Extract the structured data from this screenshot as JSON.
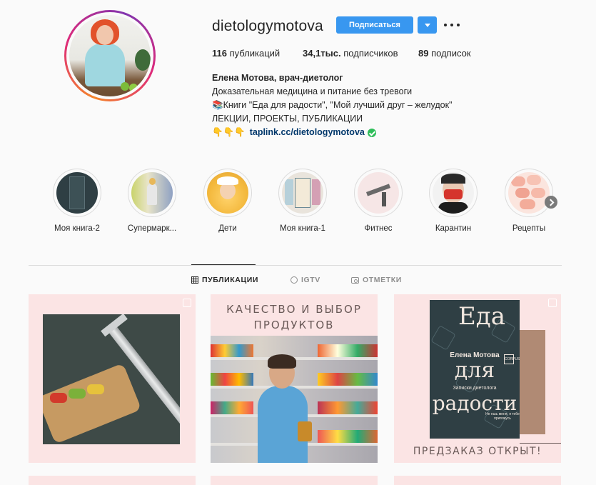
{
  "profile": {
    "username": "dietologymotova",
    "follow_label": "Подписаться",
    "stats": {
      "posts_count": "116",
      "posts_label": "публикаций",
      "followers_count": "34,1тыс.",
      "followers_label": "подписчиков",
      "following_count": "89",
      "following_label": "подписок"
    },
    "bio": {
      "name": "Елена Мотова, врач-диетолог",
      "line1": "Доказательная медицина и питание без тревоги",
      "line2": "📚Книги \"Еда для радости\", \"Мой лучший друг – желудок\"",
      "line3": "ЛЕКЦИИ, ПРОЕКТЫ, ПУБЛИКАЦИИ",
      "link_prefix": "👇👇👇",
      "link": "taplink.cc/dietologymotova"
    }
  },
  "highlights": [
    {
      "label": "Моя книга-2"
    },
    {
      "label": "Супермарк..."
    },
    {
      "label": "Дети"
    },
    {
      "label": "Моя книга-1"
    },
    {
      "label": "Фитнес"
    },
    {
      "label": "Карантин"
    },
    {
      "label": "Рецепты"
    }
  ],
  "tabs": {
    "posts": "ПУБЛИКАЦИИ",
    "igtv": "IGTV",
    "tagged": "ОТМЕТКИ"
  },
  "posts": {
    "p2_title_line1": "КАЧЕСТВО И ВЫБОР",
    "p2_title_line2": "ПРОДУКТОВ",
    "p3_book_w1": "Еда",
    "p3_book_w2": "для",
    "p3_book_w3": "радости",
    "p3_author": "Елена Мотова",
    "p3_subtitle": "Записки диетолога",
    "p3_bottom_text": "Не ешь меня, я тебе пригожусь",
    "p3_publisher": "CORPUS",
    "p3_footer": "ПРЕДЗАКАЗ ОТКРЫТ!"
  },
  "colors": {
    "accent": "#3897f0",
    "verified": "#2ebd59",
    "link": "#00376b",
    "post_bg": "#fbe4e4"
  },
  "icons": [
    "dropdown-chevron-icon",
    "more-options-icon",
    "verified-icon",
    "grid-icon",
    "igtv-icon",
    "tagged-icon",
    "next-arrow-icon",
    "multi-post-icon"
  ]
}
